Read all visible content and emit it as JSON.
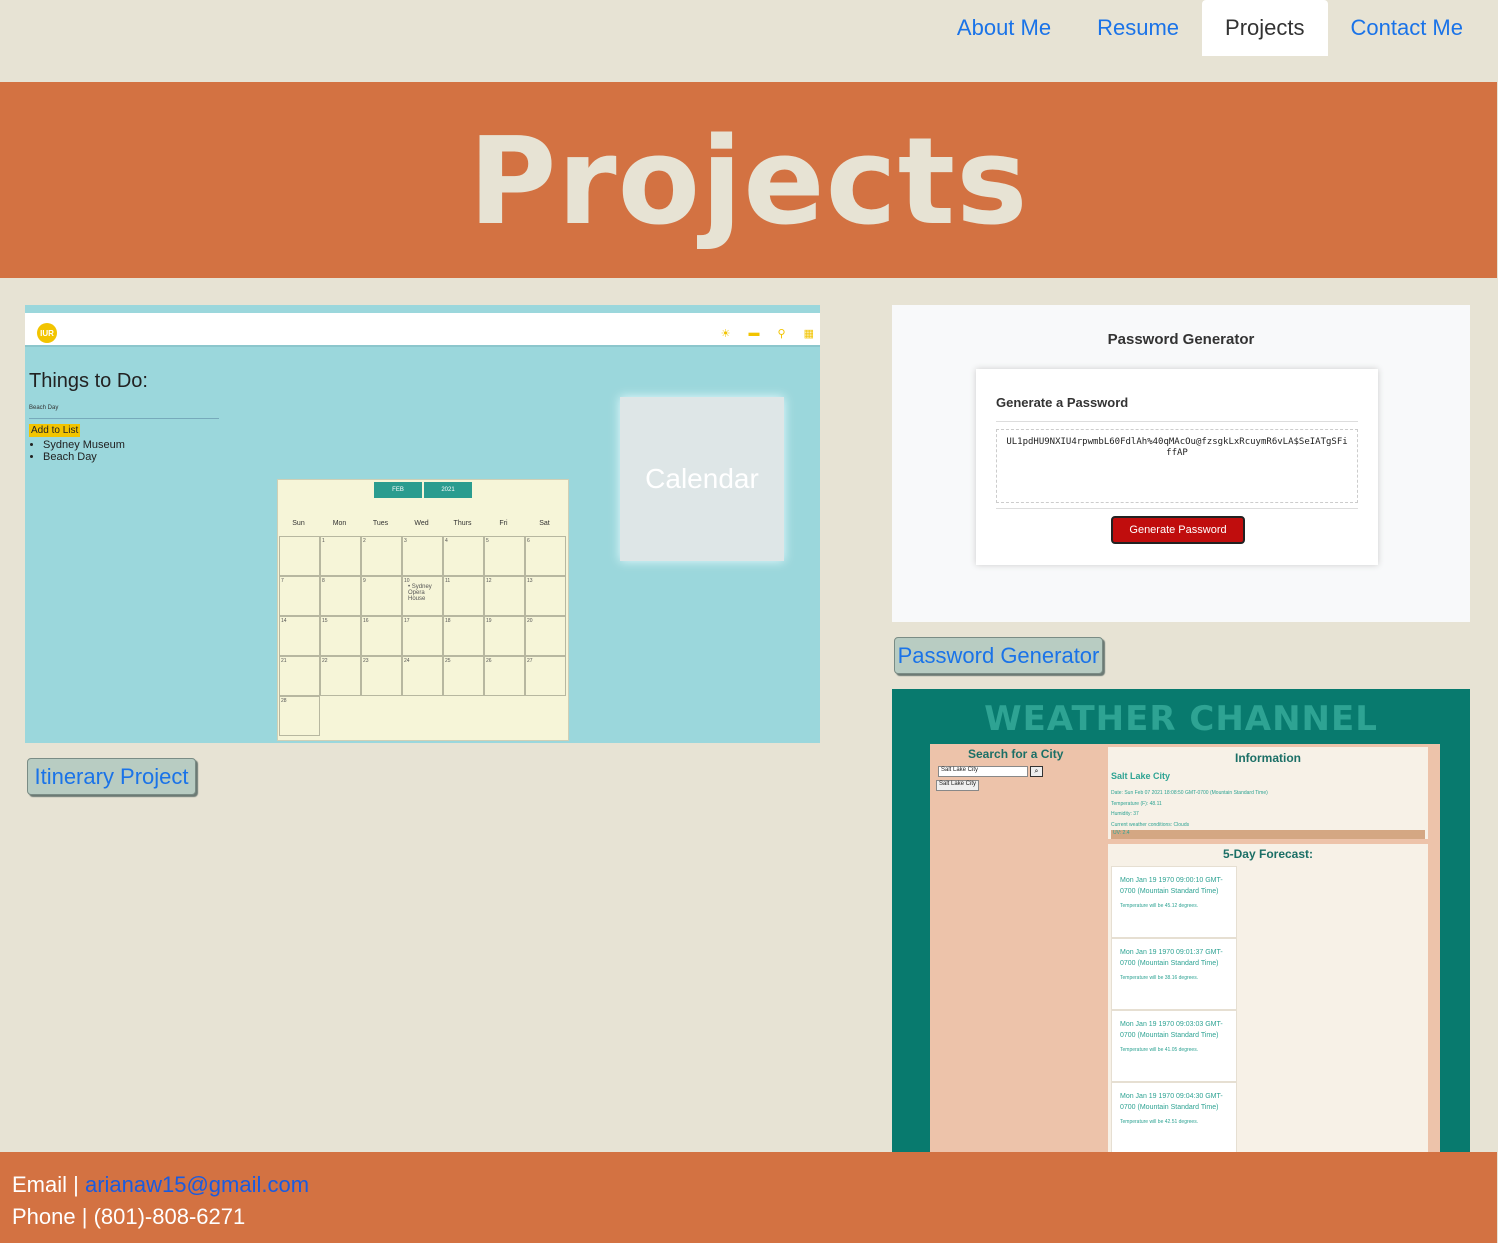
{
  "nav": {
    "items": [
      {
        "label": "About Me"
      },
      {
        "label": "Resume"
      },
      {
        "label": "Projects"
      },
      {
        "label": "Contact Me"
      }
    ]
  },
  "hero": {
    "title": "Projects"
  },
  "projects": {
    "itinerary": {
      "button_label": "Itinerary Project",
      "shot": {
        "logo": "IUR",
        "todo_title": "Things to Do:",
        "todo_input": "Beach Day",
        "add_button": "Add to List",
        "list": [
          "Sydney Museum",
          "Beach Day"
        ],
        "calendar_tile": "Calendar",
        "month": "FEB",
        "year": "2021",
        "weekdays": [
          "Sun",
          "Mon",
          "Tues",
          "Wed",
          "Thurs",
          "Fri",
          "Sat"
        ],
        "event": "Sydney Opera House"
      }
    },
    "password": {
      "button_label": "Password Generator",
      "shot": {
        "title": "Password Generator",
        "card_title": "Generate a Password",
        "password": "UL1pdHU9NXIU4rpwmbL60FdlAh%40qMAcOu@fzsgkLxRcuymR6vLA$SeIATgSFiffAP",
        "generate_button": "Generate Password"
      }
    },
    "weather": {
      "shot": {
        "title": "WEATHER CHANNEL",
        "search_title": "Search for a City",
        "search_value": "Salt Lake City",
        "city_button": "Salt Lake City",
        "info_title": "Information",
        "info_city": "Salt Lake City",
        "info_lines": [
          "Date: Sun Feb 07 2021 18:08:50 GMT-0700 (Mountain Standard Time)",
          "Temperature (F): 48.11",
          "Humidity: 37",
          "Current weather conditions: Clouds"
        ],
        "uv": "UV: 2.4",
        "forecast_title": "5-Day Forecast:",
        "forecast": [
          {
            "date": "Mon Jan 19 1970 09:00:10 GMT-0700 (Mountain Standard Time)",
            "temp": "Temperature will be 45.12 degrees."
          },
          {
            "date": "Mon Jan 19 1970 09:01:37 GMT-0700 (Mountain Standard Time)",
            "temp": "Temperature will be 38.16 degrees."
          },
          {
            "date": "Mon Jan 19 1970 09:03:03 GMT-0700 (Mountain Standard Time)",
            "temp": "Temperature will be 41.05 degrees."
          },
          {
            "date": "Mon Jan 19 1970 09:04:30 GMT-0700 (Mountain Standard Time)",
            "temp": "Temperature will be 42.51 degrees."
          }
        ]
      }
    }
  },
  "footer": {
    "email_label": "Email | ",
    "email": "arianaw15@gmail.com",
    "phone_label": "Phone | ",
    "phone": "(801)-808-6271"
  },
  "colors": {
    "accent": "#d37242",
    "background": "#e7e3d4",
    "link": "#1a73e8"
  }
}
